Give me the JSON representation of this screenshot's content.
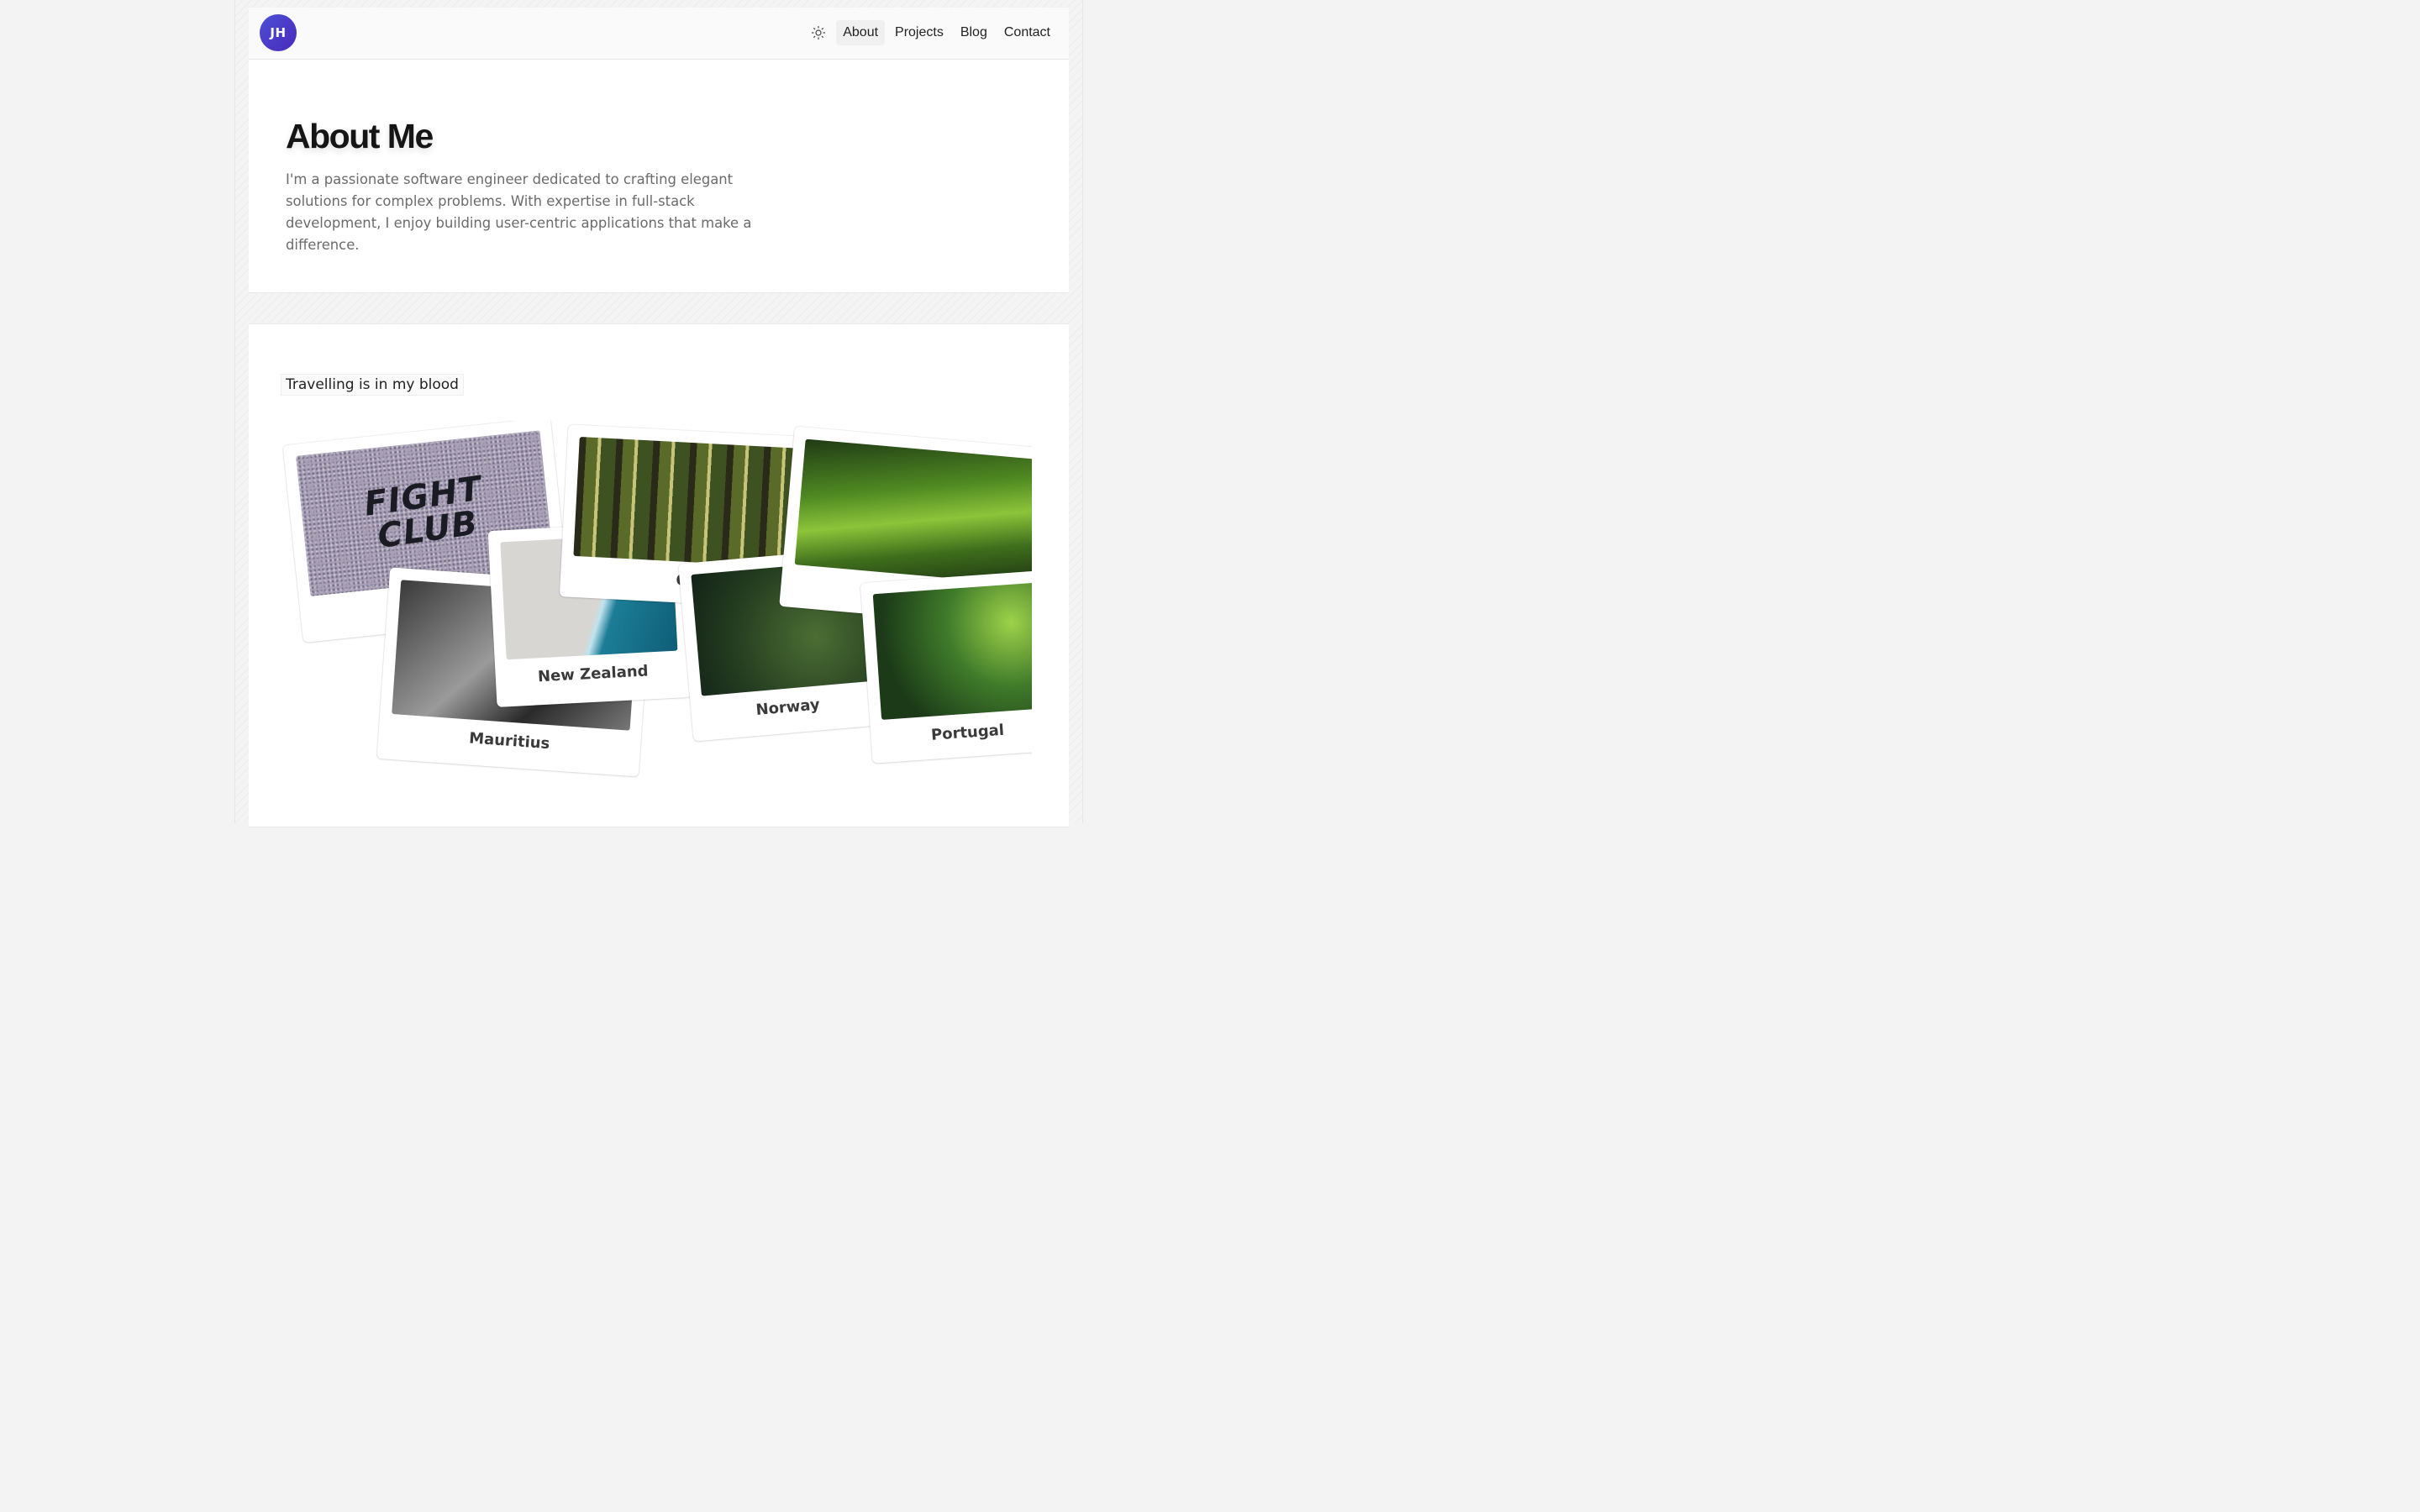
{
  "header": {
    "avatar_initials": "JH",
    "theme_icon": "sun-icon",
    "nav": [
      {
        "label": "About",
        "active": true
      },
      {
        "label": "Projects",
        "active": false
      },
      {
        "label": "Blog",
        "active": false
      },
      {
        "label": "Contact",
        "active": false
      }
    ]
  },
  "about": {
    "title": "About Me",
    "bio": "I'm a passionate software engineer dedicated to crafting elegant solutions for complex problems. With expertise in full-stack development, I enjoy building user-centric applications that make a difference."
  },
  "travel": {
    "tagline": "Travelling is in my blood",
    "photos": [
      {
        "id": "fight",
        "photo_text_line1": "FIGHT",
        "photo_text_line2": "CLUB",
        "caption": ""
      },
      {
        "id": "mauritius",
        "caption": "Mauritius"
      },
      {
        "id": "newzealand",
        "caption": "New Zealand"
      },
      {
        "id": "canada",
        "caption": "Ca"
      },
      {
        "id": "norway",
        "caption": "Norway"
      },
      {
        "id": "hills",
        "caption": ""
      },
      {
        "id": "portugal",
        "caption": "Portugal"
      }
    ]
  },
  "colors": {
    "avatar_gradient_start": "#4b4fd8",
    "avatar_gradient_end": "#4a2ab8",
    "page_background": "#f3f3f3",
    "bio_text": "#6b6b6b"
  }
}
